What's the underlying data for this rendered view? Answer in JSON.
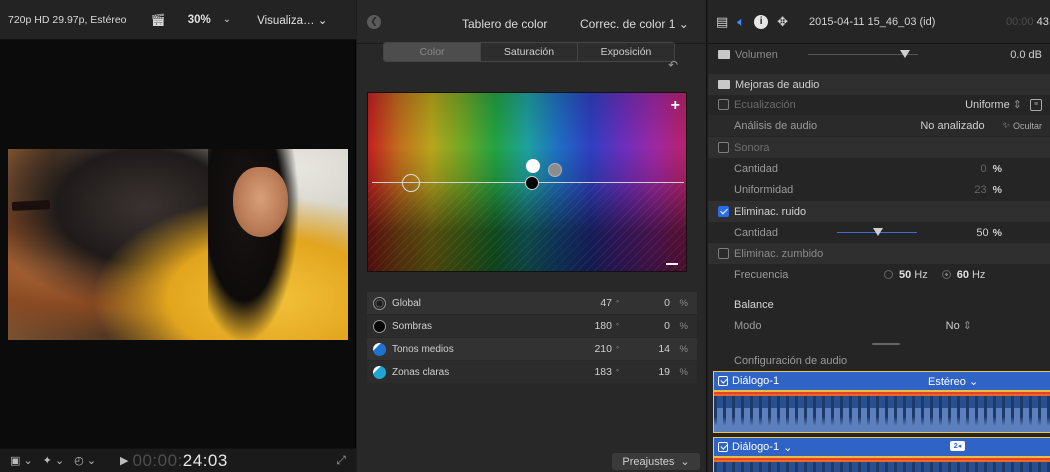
{
  "viewer": {
    "format": "720p HD 29.97p, Estéreo",
    "clapper_icon": "clapperboard-icon",
    "zoom": "30%",
    "view_menu": "Visualiza…",
    "timecode_dim": "00:00:",
    "timecode_bright": "24:03"
  },
  "color_board": {
    "title": "Tablero de color",
    "correction": "Correc. de color 1",
    "tabs": [
      "Color",
      "Saturación",
      "Exposición"
    ],
    "active_tab": "Color",
    "plus": "+",
    "rows": [
      {
        "name": "Global",
        "hue": "47",
        "value": "0"
      },
      {
        "name": "Sombras",
        "hue": "180",
        "value": "0"
      },
      {
        "name": "Tonos medios",
        "hue": "210",
        "value": "14"
      },
      {
        "name": "Zonas claras",
        "hue": "183",
        "value": "19"
      }
    ],
    "degree": "°",
    "percent": "%",
    "presets": "Preajustes"
  },
  "inspector": {
    "clip_name": "2015-04-11 15_46_03 (id)",
    "duration_dim": "00:00",
    "duration_bright": "43:0",
    "volume_label": "Volumen",
    "volume_value": "0.0 dB",
    "audio_enhancements": "Mejoras de audio",
    "equalization": "Ecualización",
    "equalization_value": "Uniforme",
    "audio_analysis": "Análisis de audio",
    "analysis_value": "No analizado",
    "hide": "Ocultar",
    "loudness": "Sonora",
    "amount": "Cantidad",
    "loudness_amount": "0",
    "uniformity": "Uniformidad",
    "uniformity_value": "23",
    "noise_removal": "Eliminac. ruido",
    "noise_amount": "50",
    "hum_removal": "Eliminac. zumbido",
    "frequency": "Frecuencia",
    "freq_50": "50",
    "freq_60": "60",
    "hz": "Hz",
    "balance": "Balance",
    "mode": "Modo",
    "mode_value": "No",
    "audio_config": "Configuración de audio",
    "lanes": [
      {
        "name": "Diálogo-1",
        "channel": "Estéreo"
      },
      {
        "name": "Diálogo-1",
        "badge": "2"
      }
    ],
    "percent": "%",
    "db": "dB"
  }
}
